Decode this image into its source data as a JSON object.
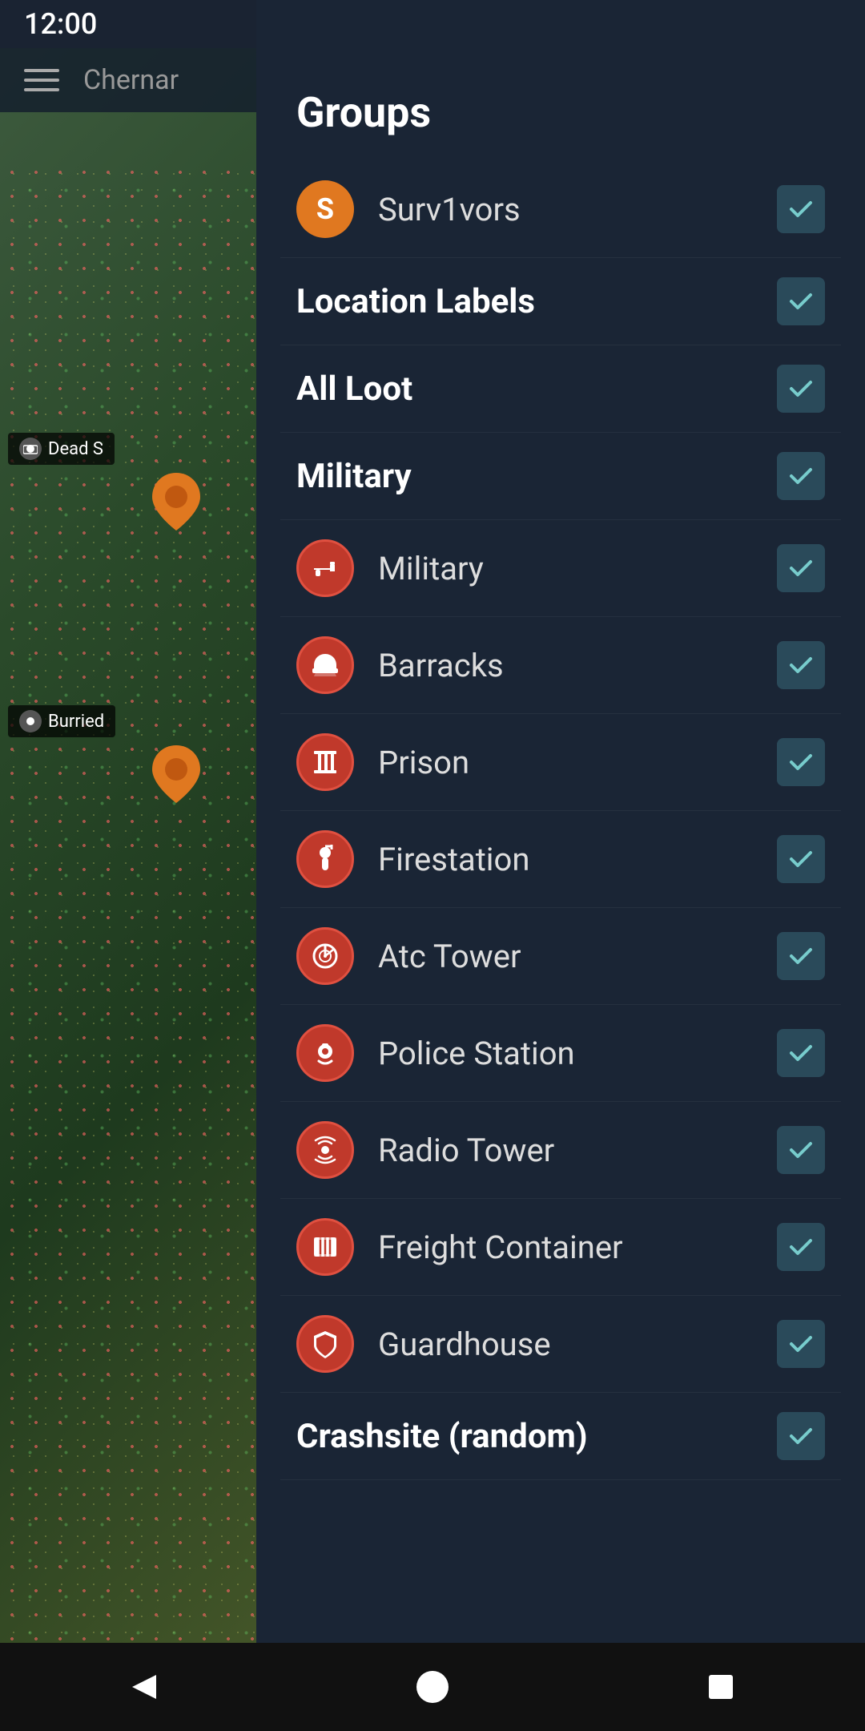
{
  "statusBar": {
    "time": "12:00"
  },
  "mapPanel": {
    "title": "Chernar",
    "labels": [
      {
        "id": "dead",
        "text": "Dead S"
      },
      {
        "id": "buried",
        "text": "Burried"
      }
    ]
  },
  "drawer": {
    "title": "Groups",
    "items": [
      {
        "id": "survivors",
        "type": "avatar",
        "icon": "S",
        "label": "Surv1vors",
        "checked": true,
        "bold": false
      },
      {
        "id": "location-labels",
        "type": "section",
        "label": "Location Labels",
        "checked": true,
        "bold": true
      },
      {
        "id": "all-loot",
        "type": "section",
        "label": "All Loot",
        "checked": true,
        "bold": true
      },
      {
        "id": "military",
        "type": "section",
        "label": "Military",
        "checked": true,
        "bold": false
      },
      {
        "id": "military-icon",
        "type": "icon",
        "iconType": "gun",
        "label": "Military",
        "checked": true,
        "bold": false
      },
      {
        "id": "barracks",
        "type": "icon",
        "iconType": "barracks",
        "label": "Barracks",
        "checked": true,
        "bold": false
      },
      {
        "id": "prison",
        "type": "icon",
        "iconType": "prison",
        "label": "Prison",
        "checked": true,
        "bold": false
      },
      {
        "id": "firestation",
        "type": "icon",
        "iconType": "fire",
        "label": "Firestation",
        "checked": true,
        "bold": false
      },
      {
        "id": "atc-tower",
        "type": "icon",
        "iconType": "atc",
        "label": "Atc Tower",
        "checked": true,
        "bold": false
      },
      {
        "id": "police-station",
        "type": "icon",
        "iconType": "police",
        "label": "Police Station",
        "checked": true,
        "bold": false
      },
      {
        "id": "radio-tower",
        "type": "icon",
        "iconType": "radio",
        "label": "Radio Tower",
        "checked": true,
        "bold": false
      },
      {
        "id": "freight-container",
        "type": "icon",
        "iconType": "freight",
        "label": "Freight Container",
        "checked": true,
        "bold": false
      },
      {
        "id": "guardhouse",
        "type": "icon",
        "iconType": "guard",
        "label": "Guardhouse",
        "checked": true,
        "bold": false
      },
      {
        "id": "crashsite",
        "type": "section",
        "label": "Crashsite (random)",
        "checked": true,
        "bold": false
      }
    ]
  },
  "navBar": {
    "back": "◀",
    "home": "●",
    "recent": "■"
  }
}
